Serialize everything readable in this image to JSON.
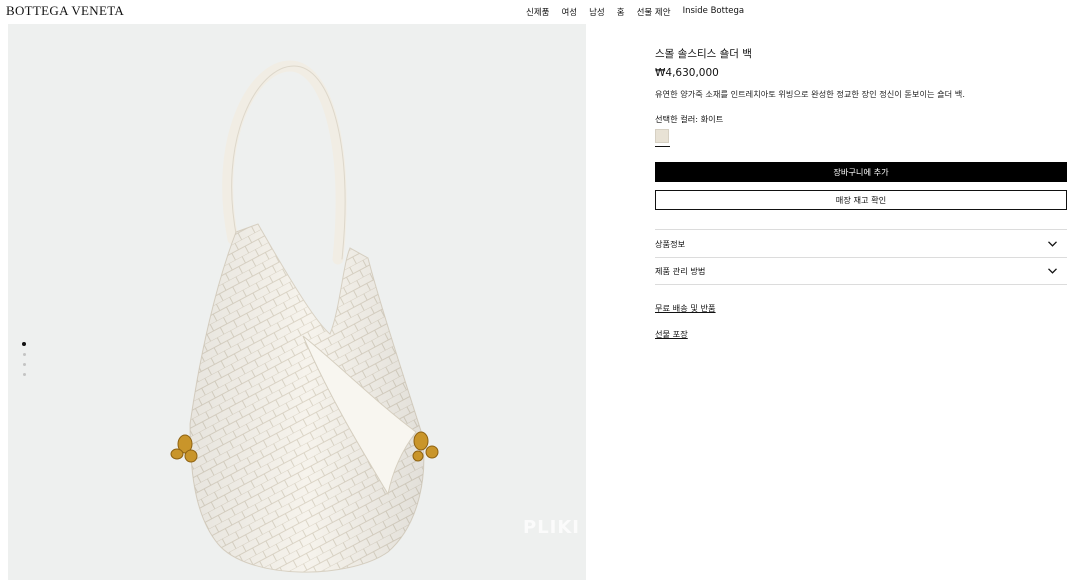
{
  "brand": {
    "logo_text": "BOTTEGA VENETA"
  },
  "nav": {
    "items": [
      {
        "label": "신제품"
      },
      {
        "label": "여성"
      },
      {
        "label": "남성"
      },
      {
        "label": "홈"
      },
      {
        "label": "선물 제안"
      },
      {
        "label": "Inside Bottega"
      }
    ]
  },
  "gallery": {
    "image_icon": "white-intrecciato-shoulder-bag",
    "watermark": "PLIKI",
    "slide_count": 4,
    "active_slide": 1
  },
  "product": {
    "title": "스몰 솔스티스 숄더 백",
    "price": "₩4,630,000",
    "description": "유연한 양가죽 소재를 인트레치아토 위빙으로 완성한 정교한 장인 정신이 돋보이는 숄더 백.",
    "color_label": "선택한 컬러: 화이트",
    "swatch_color": "#e8e2d5",
    "add_to_cart_label": "장바구니에 추가",
    "check_stock_label": "매장 재고 확인",
    "accordions": [
      {
        "label": "상품정보"
      },
      {
        "label": "제품 관리 방법"
      }
    ],
    "links": {
      "shipping": "무료 배송 및 반품",
      "gift": "선물 포장"
    }
  },
  "colors": {
    "primary_button_bg": "#000000",
    "image_background": "#eef0ef"
  }
}
